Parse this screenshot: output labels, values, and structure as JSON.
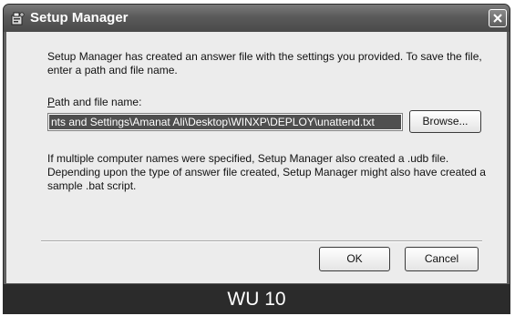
{
  "window": {
    "title": "Setup Manager",
    "title_icon": "setup-manager-icon",
    "close_icon": "close-icon"
  },
  "dialog": {
    "intro_text": "Setup Manager has created an answer file with the settings you provided. To save the file, enter a path and file name.",
    "path_label_accel": "P",
    "path_label_rest": "ath and file name:",
    "path_value": "nts and Settings\\Amanat Ali\\Desktop\\WINXP\\DEPLOY\\unattend.txt",
    "browse_label": "Browse...",
    "info_text": "If multiple computer names were specified, Setup Manager also created a .udb file. Depending upon the type of answer file created, Setup Manager might also have created a sample .bat script.",
    "ok_label": "OK",
    "cancel_label": "Cancel"
  },
  "caption": {
    "text": "WU  10"
  },
  "colors": {
    "titlebar": "#5a5a5a",
    "dialog_bg": "#ececec",
    "selection": "#4f4f4f",
    "caption_bar": "#2b2b2b"
  }
}
